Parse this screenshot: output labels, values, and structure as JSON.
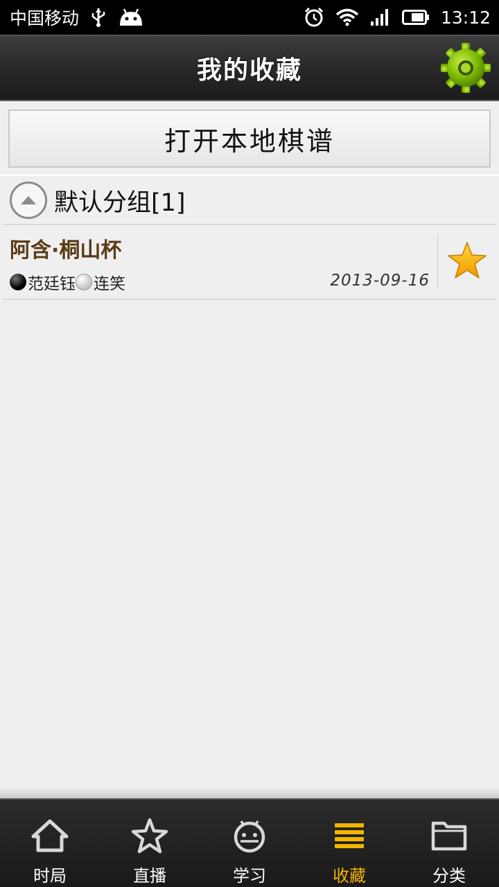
{
  "status_bar": {
    "carrier": "中国移动",
    "time": "13:12",
    "icons": [
      "usb-icon",
      "android-icon",
      "alarm-icon",
      "wifi-icon",
      "signal-icon",
      "battery-icon"
    ]
  },
  "header": {
    "title": "我的收藏",
    "settings_icon": "gear-icon",
    "accent_color": "#7ab800"
  },
  "open_local": {
    "label": "打开本地棋谱"
  },
  "group": {
    "title": "默认分组[1]",
    "icon": "collapse-up-icon"
  },
  "games": [
    {
      "title": "阿含·桐山杯",
      "black_player": "范廷钰",
      "white_player": "连笑",
      "date": "2013-09-16",
      "favorite": true
    }
  ],
  "bottom_nav": {
    "active_color": "#f3b400",
    "items": [
      {
        "label": "时局",
        "icon": "home-icon"
      },
      {
        "label": "直播",
        "icon": "star-outline-icon"
      },
      {
        "label": "学习",
        "icon": "android-face-icon"
      },
      {
        "label": "收藏",
        "icon": "list-icon",
        "active": true
      },
      {
        "label": "分类",
        "icon": "folder-icon"
      }
    ]
  }
}
